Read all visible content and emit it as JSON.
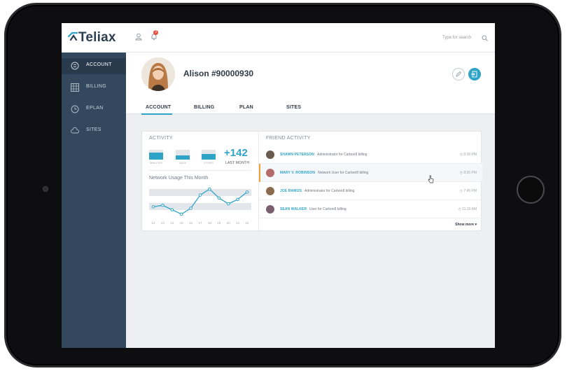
{
  "app": {
    "logo": "Teliax"
  },
  "topbar": {
    "notification_count": "3",
    "search_placeholder": "Type for search"
  },
  "sidebar": {
    "items": [
      {
        "label": "ACCOUNT",
        "icon": "account-icon",
        "active": true
      },
      {
        "label": "BILLING",
        "icon": "billing-grid-icon",
        "active": false
      },
      {
        "label": "EPLAN",
        "icon": "clock-icon",
        "active": false
      },
      {
        "label": "SITES",
        "icon": "cloud-icon",
        "active": false
      }
    ]
  },
  "profile": {
    "name": "Alison #90000930",
    "tabs": [
      "ACCOUNT",
      "BILLING",
      "PLAN",
      "SITES"
    ],
    "active_tab": "ACCOUNT"
  },
  "activity": {
    "title": "ACTIVITY",
    "bars": [
      {
        "label": "MINUTES",
        "fill": 0.75
      },
      {
        "label": "DATA",
        "fill": 0.45
      },
      {
        "label": "OTHER",
        "fill": 0.6
      }
    ],
    "total": "+142",
    "total_label": "LAST MONTH",
    "chart_title": "Network Usage This Month"
  },
  "chart_data": {
    "type": "line",
    "x": [
      "12",
      "13",
      "14",
      "15",
      "16",
      "17",
      "18",
      "19",
      "20",
      "21",
      "22"
    ],
    "values": [
      3,
      3.5,
      2,
      0.5,
      2.5,
      7,
      9,
      6,
      4,
      5.5,
      8
    ],
    "ylim": [
      0,
      10
    ],
    "grid": true,
    "colors": {
      "line": "#2fa4c6",
      "band": "#e3e7eb"
    }
  },
  "friend_activity": {
    "title": "FRIEND ACTIVITY",
    "rows": [
      {
        "name": "SHAWN PETERSON",
        "desc": "Administrator for Carbon8 billing",
        "time": "9:30 PM",
        "highlight": false
      },
      {
        "name": "MARY V. ROBINSON",
        "desc": "Network User for Carbon8 billing",
        "time": "9:30 PM",
        "highlight": true
      },
      {
        "name": "JOE RAMOS",
        "desc": "Administrator for Carbon8 billing",
        "time": "7:45 PM",
        "highlight": false
      },
      {
        "name": "SEAN WALKER",
        "desc": "User for Carbon8 billing",
        "time": "11:15 AM",
        "highlight": false
      }
    ],
    "show_more": "Show more"
  },
  "colors": {
    "accent": "#2fa4c6",
    "sidebar": "#33485c",
    "highlight": "#f0a23a",
    "badge": "#e74c3c"
  }
}
